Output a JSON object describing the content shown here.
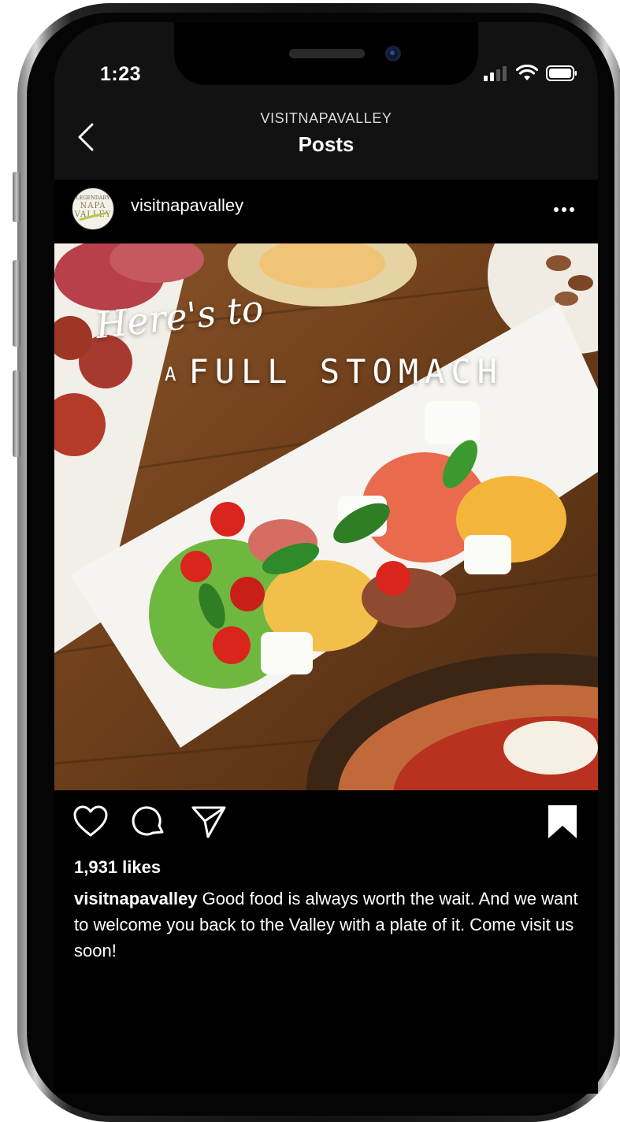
{
  "status_bar": {
    "time": "1:23"
  },
  "header": {
    "account": "VISITNAPAVALLEY",
    "title": "Posts"
  },
  "post": {
    "avatar": {
      "line1": "LEGENDARY",
      "line2": "NAPA",
      "line3": "VALLEY"
    },
    "username": "visitnapavalley",
    "image_text": {
      "line1": "Here's to",
      "line2_prefix": "A",
      "line2": "FULL STOMACH"
    },
    "likes": "1,931 likes",
    "caption_user": "visitnapavalley",
    "caption_text": " Good food is always worth the wait. And we want to welcome you back to the Valley with a plate of it. Come visit us soon!"
  },
  "icons": {
    "back": "chevron-left-icon",
    "more": "more-horizontal-icon",
    "like": "heart-icon",
    "comment": "comment-icon",
    "share": "send-icon",
    "save": "bookmark-icon"
  },
  "colors": {
    "background": "#000000",
    "header": "#121212",
    "text": "#ffffff"
  }
}
